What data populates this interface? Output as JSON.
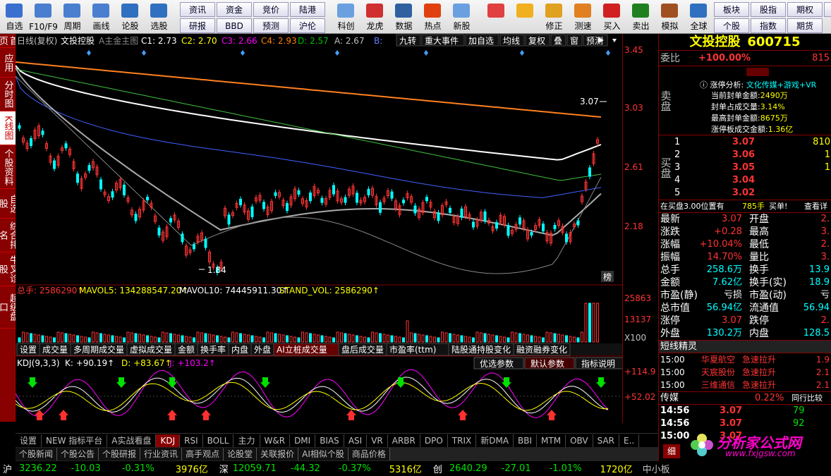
{
  "toolbar": {
    "items": [
      {
        "label": "自选",
        "icon": "star-icon",
        "color": "#3a6fd0"
      },
      {
        "label": "F10/F9",
        "icon": "f10-icon",
        "color": "#4a7fd0"
      },
      {
        "label": "周期",
        "icon": "clock-icon",
        "color": "#4a7fd0"
      },
      {
        "label": "画线",
        "icon": "pen-icon",
        "color": "#4a7fd0"
      },
      {
        "label": "论股",
        "icon": "chat-icon",
        "color": "#3070c0"
      },
      {
        "label": "选股",
        "icon": "chart-icon",
        "color": "#3070c0"
      }
    ],
    "grid": [
      [
        "资讯",
        "研报"
      ],
      [
        "资金",
        "BBD"
      ],
      [
        "竞价",
        "预测"
      ],
      [
        "陆港",
        "沪伦"
      ]
    ],
    "items2": [
      {
        "label": "科创",
        "icon": "kc-icon",
        "color": "#6aa0e0"
      },
      {
        "label": "龙虎",
        "icon": "dragon-icon",
        "color": "#d03030"
      },
      {
        "label": "数据",
        "icon": "pe-icon",
        "color": "#3060a0"
      },
      {
        "label": "热点",
        "icon": "fire-icon",
        "color": "#e04010"
      },
      {
        "label": "新股",
        "icon": "ipo-icon",
        "color": "#6aa0e0"
      }
    ],
    "items3": [
      {
        "label": "",
        "icon": "color-grid-icon",
        "color": "#e04040"
      },
      {
        "label": "",
        "icon": "back-arrow-icon",
        "color": "#f0b020"
      },
      {
        "label": "修正",
        "icon": "updown-icon",
        "color": "#e0a020"
      },
      {
        "label": "测速",
        "icon": "timer-icon",
        "color": "#e08020"
      },
      {
        "label": "买入",
        "icon": "buy-icon",
        "color": "#d02020"
      },
      {
        "label": "卖出",
        "icon": "sell-icon",
        "color": "#208020"
      },
      {
        "label": "模拟",
        "icon": "hammer-icon",
        "color": "#a05020"
      },
      {
        "label": "全球",
        "icon": "globe-icon",
        "color": "#3070c0"
      }
    ],
    "grid2": [
      [
        "板块",
        "个股"
      ],
      [
        "股指",
        "指数"
      ],
      [
        "期权",
        "期货"
      ],
      [
        "债",
        ""
      ]
    ]
  },
  "left_tabs": [
    "首页",
    "应用",
    "分时图",
    "K线图",
    "个股资料",
    "自选股",
    "综合排名",
    "牛叉诊股",
    "超级盘口"
  ],
  "chart": {
    "title_bar": {
      "period": "日线(复权)",
      "name": "文投控股",
      "main": "A主金主图",
      "c1": "C1: 2.73",
      "c2": "C2: 2.70",
      "c3": "C3: 2.66",
      "c4": "C4: 2.93",
      "d": "D: 2.57",
      "a": "A: 2.67",
      "b": "B:"
    },
    "top_buttons": [
      "九转",
      "重大事件",
      "加自选",
      "均线",
      "复权",
      "叠",
      "窗",
      "预测"
    ],
    "y_labels": [
      "3.45",
      "3.03",
      "2.61",
      "2.18"
    ],
    "hi_label": "3.07",
    "lo_label": "1.84",
    "bang": "榜",
    "vol_title": {
      "a": "总手: 2586290↑",
      "b": "MAVOL5: 134288547.20↑",
      "c": "MAVOL10: 74445911.30↑",
      "d": "STAND_VOL: 2586290↑"
    },
    "vol_y": [
      "25863",
      "13137",
      "X100"
    ],
    "sub_tabs": [
      "设置",
      "成交量",
      "多周期成交量",
      "虚拟成交量",
      "金额",
      "换手率",
      "内盘",
      "外盘",
      "AI立桩成交量",
      "盘后成交量",
      "市盈率(ttm)",
      "陆股通持股变化",
      "融资融券变化"
    ],
    "kdj_title": {
      "a": "KDJ(9,3,3)",
      "k": "K: +90.19↑",
      "d": "D: +83.67↑",
      "j": "J: +103.2↑"
    },
    "kdj_buttons": [
      "优选参数",
      "默认参数",
      "指标说明"
    ],
    "kdj_y": [
      "+114.9",
      "+52.02"
    ],
    "months": [
      "03",
      "04",
      "05",
      "06",
      "07",
      "08"
    ]
  },
  "bottom_tabs": [
    "设置",
    "NEW 指标平台",
    "A实战看盘",
    "KDJ",
    "RSI",
    "BOLL",
    "主力",
    "W&R",
    "DMI",
    "BIAS",
    "ASI",
    "VR",
    "ARBR",
    "DPO",
    "TRIX",
    "新DMA",
    "BBI",
    "MTM",
    "OBV",
    "SAR",
    "E.."
  ],
  "news_tabs": [
    "个股新闻",
    "个股公告",
    "个股研报",
    "行业资讯",
    "高手观点",
    "论股堂",
    "关联报价",
    "AI相似个股",
    "商品价格"
  ],
  "right": {
    "stock_name": "文投控股",
    "stock_code": "600715",
    "weibi_label": "委比",
    "weibi_value": "+100.00%",
    "weibi_right": "815",
    "zt": {
      "title": "涨停分析:",
      "tag": "文化传媒+游戏+VR",
      "rows": [
        [
          "当前封单金额:",
          "2490万"
        ],
        [
          "封单占成交量:",
          "3.14%"
        ],
        [
          "最高封单金额:",
          "8675万"
        ],
        [
          "涨停板成交金额:",
          "1.36亿"
        ]
      ]
    },
    "sell_label": "卖盘",
    "buy_label": "买盘",
    "bids": [
      [
        "1",
        "3.07",
        "810"
      ],
      [
        "2",
        "3.06",
        "1"
      ],
      [
        "3",
        "3.05",
        "1"
      ],
      [
        "4",
        "3.04",
        ""
      ],
      [
        "5",
        "3.02",
        ""
      ]
    ],
    "buy_tip": {
      "a": "在买盘3.00位置有",
      "b": "785手",
      "c": "买单!",
      "d": "查看详"
    },
    "quotes": [
      [
        "最新",
        "3.07",
        "red",
        "开盘",
        "2.",
        ""
      ],
      [
        "涨跌",
        "+0.28",
        "red",
        "最高",
        "3.",
        ""
      ],
      [
        "涨幅",
        "+10.04%",
        "red",
        "最低",
        "2.",
        ""
      ],
      [
        "振幅",
        "14.70%",
        "red",
        "量比",
        "3.",
        ""
      ],
      [
        "总手",
        "258.6万",
        "cyn",
        "换手",
        "13.9",
        ""
      ],
      [
        "金额",
        "7.62亿",
        "cyn",
        "换手(实)",
        "18.9",
        ""
      ],
      [
        "市盈(静)",
        "亏损",
        "wht",
        "市盈(动)",
        "亏",
        ""
      ],
      [
        "总市值",
        "56.94亿",
        "cyn",
        "流通值",
        "56.94",
        ""
      ],
      [
        "涨停",
        "3.07",
        "red",
        "跌停",
        "2.",
        ""
      ],
      [
        "外盘",
        "130.2万",
        "cyn",
        "内盘",
        "128.5",
        ""
      ]
    ],
    "short_title": "短线精灵",
    "short_rows": [
      [
        "15:00",
        "华夏航空",
        "急速拉升",
        "1.9"
      ],
      [
        "15:00",
        "天宸股份",
        "急速拉升",
        "2.1"
      ],
      [
        "15:00",
        "三维通信",
        "急速拉升",
        "2.1"
      ]
    ],
    "sector": {
      "name": "传媒",
      "pct": "0.22%",
      "compare": "同行比较"
    },
    "ticks": [
      [
        "14:56",
        "3.07",
        "79"
      ],
      [
        "14:56",
        "3.07",
        "92"
      ],
      [
        "15:00",
        "3.07",
        ""
      ]
    ],
    "tick_tab": "细",
    "watermark": {
      "text": "分析家公式网",
      "url": "www.fxjgsw.com"
    }
  },
  "status": {
    "sh": {
      "label": "沪",
      "price": "3236.22",
      "chg": "-10.03",
      "pct": "-0.31%",
      "amt": "3976亿"
    },
    "sz": {
      "label": "深",
      "price": "12059.71",
      "chg": "-44.32",
      "pct": "-0.37%",
      "amt": "5316亿"
    },
    "cy": {
      "label": "创",
      "price": "2640.29",
      "chg": "-27.01",
      "pct": "-1.01%",
      "amt": "1720亿"
    },
    "right": "中小板"
  }
}
